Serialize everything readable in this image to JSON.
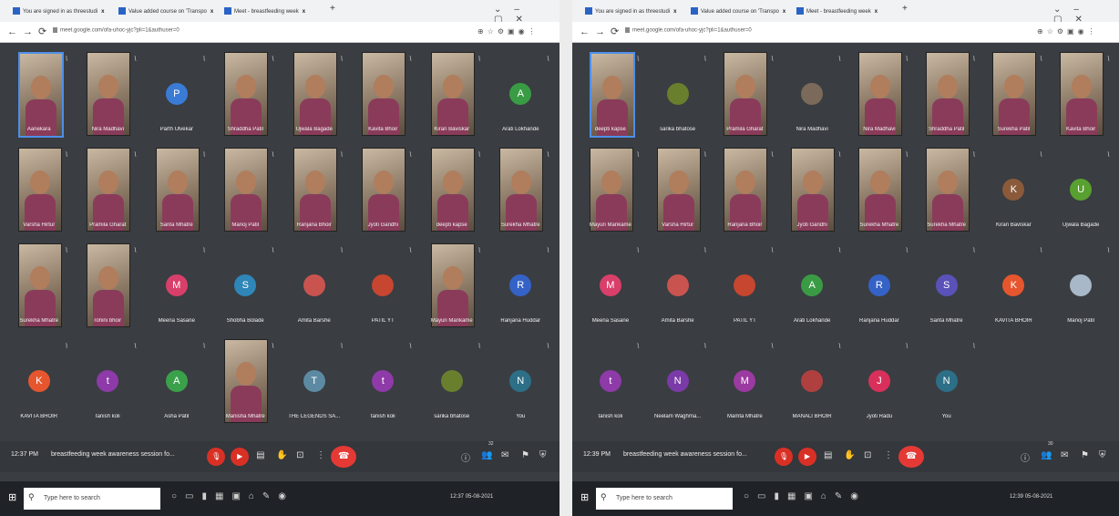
{
  "windows": [
    {
      "tabs": [
        {
          "label": "You are signed in as threestudi"
        },
        {
          "label": "Value added course on 'Transpo"
        },
        {
          "label": "Meet - breastfeeding week"
        }
      ],
      "url": "meet.google.com/ofa-uhoc-yjc?pli=1&authuser=0",
      "clock": "12:37 PM",
      "meeting_title": "breastfeeding week awareness session fo...",
      "people_count": "32",
      "search_placeholder": "Type here to search",
      "tray_time": "12:37",
      "tray_date": "05-08-2021",
      "participants": [
        {
          "name": "Aanekara",
          "kind": "video",
          "self": true
        },
        {
          "name": "Nira Madhavi",
          "kind": "video"
        },
        {
          "name": "Parth Ulvekar",
          "kind": "avatar",
          "initial": "P",
          "color": "#3a7bd5"
        },
        {
          "name": "Shraddha Patil",
          "kind": "video"
        },
        {
          "name": "Ujwala Bagade",
          "kind": "video"
        },
        {
          "name": "Kavita Bhoir",
          "kind": "video"
        },
        {
          "name": "Kiran Baviskar",
          "kind": "video"
        },
        {
          "name": "Arati Lokhande",
          "kind": "avatar",
          "initial": "A",
          "color": "#3a9b45"
        },
        {
          "name": "Varsha Hirtur",
          "kind": "video"
        },
        {
          "name": "Pramila Gharat",
          "kind": "video"
        },
        {
          "name": "Sarita Mhatre",
          "kind": "video"
        },
        {
          "name": "Manoj Patil",
          "kind": "video"
        },
        {
          "name": "Ranjana Bhoir",
          "kind": "video"
        },
        {
          "name": "Jyoti Gandhi",
          "kind": "video"
        },
        {
          "name": "deepti kapse",
          "kind": "video"
        },
        {
          "name": "Surekha Mhatre",
          "kind": "video"
        },
        {
          "name": "Surekha Mhatre",
          "kind": "video"
        },
        {
          "name": "rohini bhoir",
          "kind": "video"
        },
        {
          "name": "Meena Sasane",
          "kind": "avatar",
          "initial": "M",
          "color": "#d83f6a"
        },
        {
          "name": "Shobha Bolade",
          "kind": "avatar",
          "initial": "S",
          "color": "#2f86b8"
        },
        {
          "name": "Amita Barshe",
          "kind": "avatar",
          "initial": "",
          "color": "#c9544f"
        },
        {
          "name": "PATIL YT",
          "kind": "avatar",
          "initial": "",
          "color": "#c7462f"
        },
        {
          "name": "Mayuri Mankame",
          "kind": "video"
        },
        {
          "name": "Ranjana Huddar",
          "kind": "avatar",
          "initial": "R",
          "color": "#3562c6"
        },
        {
          "name": "KAVITA BHOIR",
          "kind": "avatar",
          "initial": "K",
          "color": "#e6562e"
        },
        {
          "name": "tanish koli",
          "kind": "avatar",
          "initial": "t",
          "color": "#8e3aa8"
        },
        {
          "name": "Asha Patil",
          "kind": "avatar",
          "initial": "A",
          "color": "#3aa14a"
        },
        {
          "name": "Manisha Mhatre",
          "kind": "video"
        },
        {
          "name": "THE LEGENDS SA...",
          "kind": "avatar",
          "initial": "T",
          "color": "#5d8aa3"
        },
        {
          "name": "tanish koli",
          "kind": "avatar",
          "initial": "t",
          "color": "#8e3aa8"
        },
        {
          "name": "sarika bhatose",
          "kind": "avatar",
          "initial": "",
          "color": "#6a7f2e"
        },
        {
          "name": "You",
          "kind": "avatar",
          "initial": "N",
          "color": "#2c6f86"
        }
      ]
    },
    {
      "tabs": [
        {
          "label": "You are signed in as threestudi"
        },
        {
          "label": "Value added course on 'Transpo"
        },
        {
          "label": "Meet - breastfeeding week"
        }
      ],
      "url": "meet.google.com/ofa-uhoc-yjc?pli=1&authuser=0",
      "clock": "12:39 PM",
      "meeting_title": "breastfeeding week awareness session fo...",
      "people_count": "30",
      "search_placeholder": "Type here to search",
      "tray_time": "12:39",
      "tray_date": "05-08-2021",
      "participants": [
        {
          "name": "deepti kapse",
          "kind": "video",
          "self": true
        },
        {
          "name": "sarika bhatose",
          "kind": "avatar",
          "initial": "",
          "color": "#6a7f2e"
        },
        {
          "name": "Pramila Gharat",
          "kind": "video"
        },
        {
          "name": "Nira Madhavi",
          "kind": "avatar",
          "initial": "",
          "color": "#7b6a5a"
        },
        {
          "name": "Nira Madhavi",
          "kind": "video"
        },
        {
          "name": "Shraddha Patil",
          "kind": "video"
        },
        {
          "name": "Surekha Patil",
          "kind": "video"
        },
        {
          "name": "Kavita Bhoir",
          "kind": "video"
        },
        {
          "name": "Mayuri Mankame",
          "kind": "video"
        },
        {
          "name": "Varsha Hirtur",
          "kind": "video"
        },
        {
          "name": "Ranjana Bhoir",
          "kind": "video"
        },
        {
          "name": "Jyoti Gandhi",
          "kind": "video"
        },
        {
          "name": "Surekha Mhatre",
          "kind": "video"
        },
        {
          "name": "Surekha Mhatre",
          "kind": "video"
        },
        {
          "name": "Kiran Baviskar",
          "kind": "avatar",
          "initial": "K",
          "color": "#8a5a3a"
        },
        {
          "name": "Ujwala Bagade",
          "kind": "avatar",
          "initial": "U",
          "color": "#58a02f"
        },
        {
          "name": "Meena Sasane",
          "kind": "avatar",
          "initial": "M",
          "color": "#d83f6a"
        },
        {
          "name": "Amita Barshe",
          "kind": "avatar",
          "initial": "",
          "color": "#c9544f"
        },
        {
          "name": "PATIL YT",
          "kind": "avatar",
          "initial": "",
          "color": "#c7462f"
        },
        {
          "name": "Arati Lokhande",
          "kind": "avatar",
          "initial": "A",
          "color": "#3a9b45"
        },
        {
          "name": "Ranjana Huddar",
          "kind": "avatar",
          "initial": "R",
          "color": "#3562c6"
        },
        {
          "name": "Sarita Mhatre",
          "kind": "avatar",
          "initial": "S",
          "color": "#5a52b8"
        },
        {
          "name": "KAVITA BHOIR",
          "kind": "avatar",
          "initial": "K",
          "color": "#e6562e"
        },
        {
          "name": "Manoj Patil",
          "kind": "avatar",
          "initial": "",
          "color": "#a8b8c8"
        },
        {
          "name": "tanish koli",
          "kind": "avatar",
          "initial": "t",
          "color": "#8e3aa8"
        },
        {
          "name": "Neelam Waghma...",
          "kind": "avatar",
          "initial": "N",
          "color": "#7a3aa8"
        },
        {
          "name": "Mamta Mhatre",
          "kind": "avatar",
          "initial": "M",
          "color": "#9b3aa0"
        },
        {
          "name": "MANALI BHOIR",
          "kind": "avatar",
          "initial": "",
          "color": "#b04040"
        },
        {
          "name": "Jyoti Radu",
          "kind": "avatar",
          "initial": "J",
          "color": "#d8305a"
        },
        {
          "name": "You",
          "kind": "avatar",
          "initial": "N",
          "color": "#2c6f86"
        }
      ]
    }
  ]
}
